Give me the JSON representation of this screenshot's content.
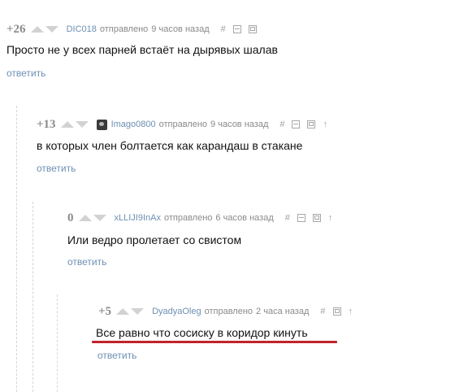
{
  "comments": [
    {
      "rating": "+26",
      "author": "DIC018",
      "sent": "отправлено",
      "time": "9 часов назад",
      "text": "Просто не у всех парней встаёт на дырявых шалав",
      "reply": "ответить"
    },
    {
      "rating": "+13",
      "author": "Imago0800",
      "sent": "отправлено",
      "time": "9 часов назад",
      "text": "в которых член болтается как карандаш в стакане",
      "reply": "ответить"
    },
    {
      "rating": "0",
      "author": "xLLIJI9InAx",
      "sent": "отправлено",
      "time": "6 часов назад",
      "text": "Или ведро пролетает со свистом",
      "reply": "ответить"
    },
    {
      "rating": "+5",
      "author": "DyadyaOleg",
      "sent": "отправлено",
      "time": "2 часа назад",
      "text": "Все равно что сосиску в коридор кинуть",
      "reply": "ответить"
    }
  ],
  "icons": {
    "link": "#",
    "parent": "↑",
    "vote_up": "triangle-up-icon",
    "vote_down": "triangle-down-icon"
  },
  "colors": {
    "accent_link": "#6d8fb3",
    "meta_gray": "#8a8a8a",
    "highlight_underline": "#c0232b"
  }
}
